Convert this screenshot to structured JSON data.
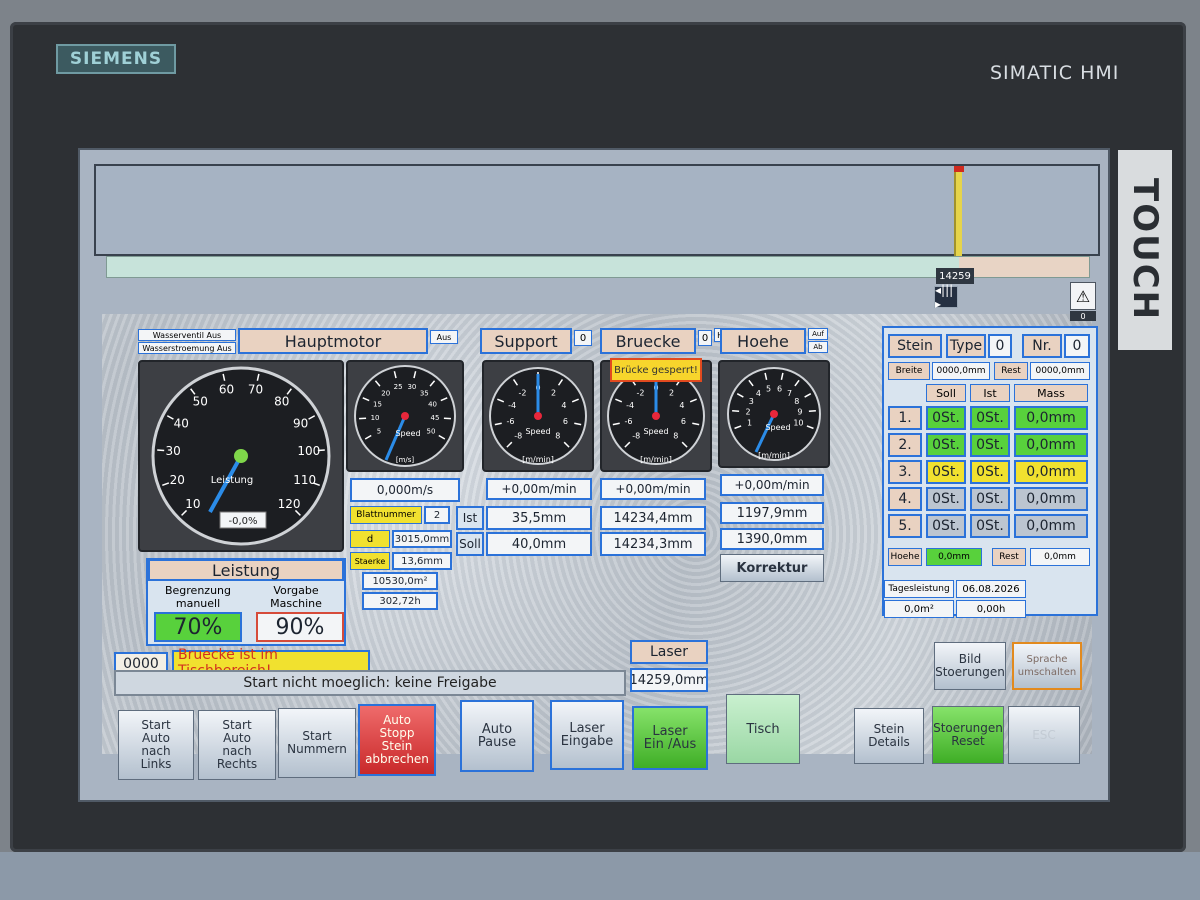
{
  "device": {
    "brand": "SIEMENS",
    "model": "SIMATIC HMI",
    "side_label": "TOUCH"
  },
  "header": {
    "position_badge": "14259",
    "handle_icon": "slider-handle-icon",
    "warning_icon": "warning-triangle-icon",
    "warning_count": "0"
  },
  "hauptmotor": {
    "label": "Hauptmotor",
    "state": "Aus",
    "wasserventil": "Wasserventil Aus",
    "wasserstroemung": "Wasserstroemung Aus",
    "gauge_label": "Leistung",
    "gauge_value": "-0,0%",
    "gauge_ticks": [
      "10",
      "20",
      "30",
      "40",
      "50",
      "60",
      "70",
      "80",
      "90",
      "100",
      "110",
      "120"
    ]
  },
  "blade_gauge": {
    "unit": "[m/s]",
    "value_label": "Speed",
    "ticks": [
      "5",
      "10",
      "15",
      "20",
      "25",
      "30",
      "35",
      "40",
      "45",
      "50"
    ],
    "reading": "0,000m/s"
  },
  "blade_info": {
    "blattnummer_label": "Blattnummer",
    "blattnummer": "2",
    "d_label": "d",
    "d_value": "3015,0mm",
    "staerke_label": "Staerke",
    "staerke": "13,6mm",
    "area": "10530,0m²",
    "hours": "302,72h"
  },
  "leistung": {
    "title": "Leistung",
    "begrenzung_label": "Begrenzung\nmanuell",
    "vorgabe_label": "Vorgabe\nMaschine",
    "begrenzung_value": "70%",
    "vorgabe_value": "90%"
  },
  "support": {
    "label": "Support",
    "count": "0",
    "speed": "+0,00m/min",
    "ist": "35,5mm",
    "soll": "40,0mm"
  },
  "bruecke": {
    "label": "Bruecke",
    "count": "0",
    "hyd": "Hyd",
    "speed": "+0,00m/min",
    "ist": "14234,4mm",
    "soll": "14234,3mm",
    "popup": "Brücke gesperrt!"
  },
  "hoehe": {
    "label": "Hoehe",
    "auf": "Auf",
    "ab": "Ab",
    "speed": "+0,00m/min",
    "ist": "1197,9mm",
    "soll": "1390,0mm",
    "korrektur": "Korrektur"
  },
  "row_labels": {
    "ist": "Ist",
    "soll": "Soll"
  },
  "speed_gauges": {
    "label": "Speed",
    "unit": "[m/min]",
    "ticks_sym": [
      "-8",
      "-6",
      "-4",
      "-2",
      "0",
      "2",
      "4",
      "6",
      "8"
    ],
    "ticks_hoehe": [
      "1",
      "2",
      "3",
      "4",
      "5",
      "6",
      "7",
      "8",
      "9",
      "10"
    ]
  },
  "stein": {
    "stein_label": "Stein",
    "type_label": "Type",
    "type_value": "0",
    "nr_label": "Nr.",
    "nr_value": "0",
    "breite_label": "Breite",
    "breite_value": "0000,0mm",
    "rest_label": "Rest",
    "rest_value": "0000,0mm",
    "headers": [
      "Soll",
      "Ist",
      "Mass"
    ],
    "rows": [
      {
        "idx": "1.",
        "soll": "0St.",
        "ist": "0St.",
        "mass": "0,0mm",
        "color": "green"
      },
      {
        "idx": "2.",
        "soll": "0St.",
        "ist": "0St.",
        "mass": "0,0mm",
        "color": "green"
      },
      {
        "idx": "3.",
        "soll": "0St.",
        "ist": "0St.",
        "mass": "0,0mm",
        "color": "yellow"
      },
      {
        "idx": "4.",
        "soll": "0St.",
        "ist": "0St.",
        "mass": "0,0mm",
        "color": "grey"
      },
      {
        "idx": "5.",
        "soll": "0St.",
        "ist": "0St.",
        "mass": "0,0mm",
        "color": "grey"
      }
    ],
    "hoehe_label": "Hoehe",
    "hoehe_value": "0,0mm",
    "rest2_label": "Rest",
    "rest2_value": "0,0mm",
    "tagesleistung_label": "Tagesleistung",
    "date": "06.08.2026",
    "area": "0,0m²",
    "hours": "0,00h"
  },
  "status": {
    "code": "0000",
    "alarm": "Bruecke ist im Tischbereich!",
    "message": "Start nicht moeglich: keine Freigabe"
  },
  "laser": {
    "label": "Laser",
    "value": "14259,0mm"
  },
  "buttons": {
    "start_links": "Start\nAuto\nnach\nLinks",
    "start_rechts": "Start\nAuto\nnach\nRechts",
    "start_nummern": "Start\nNummern",
    "auto_stopp": "Auto\nStopp\nStein\nabbrechen",
    "auto_pause": "Auto\nPause",
    "laser_eingabe": "Laser\nEingabe",
    "laser_ein_aus": "Laser\nEin /Aus",
    "tisch": "Tisch",
    "stein_details": "Stein\nDetails",
    "stoerungen_reset": "Stoerungen\nReset",
    "esc": "ESC",
    "bild_stoerungen": "Bild\nStoerungen",
    "sprache": "Sprache\numschalten"
  },
  "colors": {
    "accent": "#2b72d9",
    "ok": "#58d13c",
    "warn": "#f1e12f",
    "alarm_text": "#d3331e"
  }
}
